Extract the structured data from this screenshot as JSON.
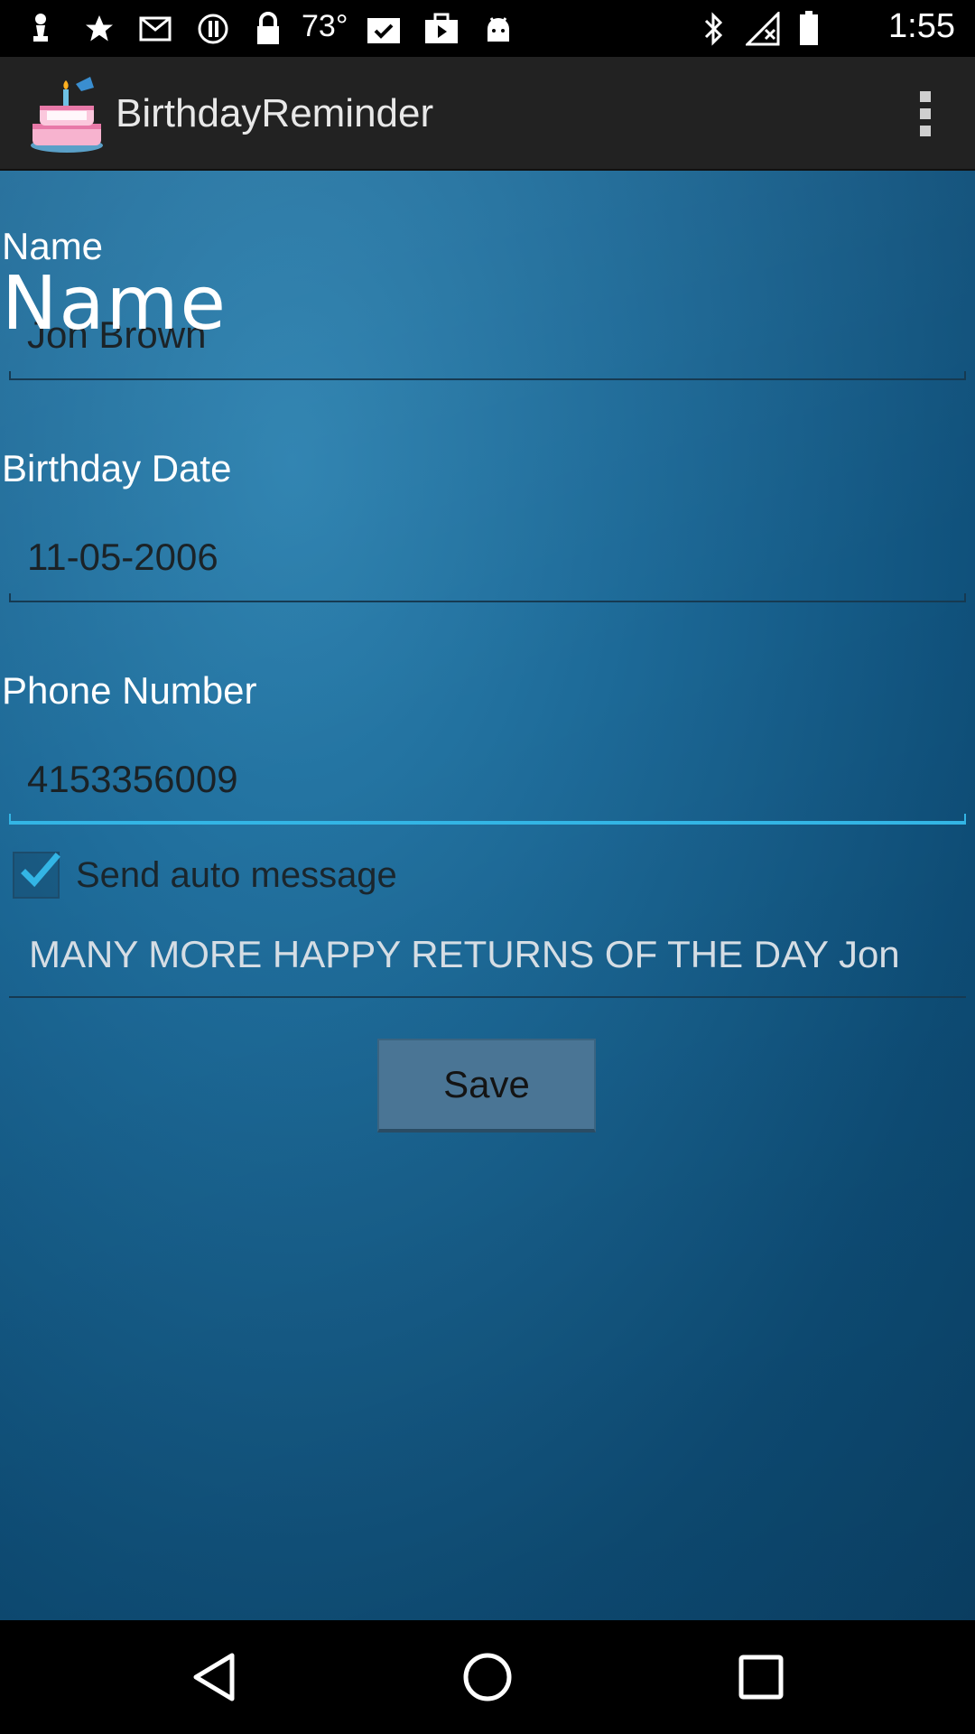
{
  "status_bar": {
    "temperature": "73°",
    "time": "1:55",
    "icons": [
      "chess-pawn-icon",
      "star-icon",
      "mail-icon",
      "info-circle-icon",
      "lock-icon",
      "temperature-text",
      "clipboard-check-icon",
      "briefcase-play-icon",
      "android-icon",
      "bluetooth-icon",
      "signal-off-icon",
      "battery-icon"
    ]
  },
  "action_bar": {
    "title": "BirthdayReminder",
    "icon": "birthday-cake-icon",
    "overflow": "overflow-menu-icon"
  },
  "form": {
    "name_label": "Name",
    "name_overlay": "Name",
    "name_value": "Jon Brown",
    "birthday_label": "Birthday Date",
    "birthday_value": "11-05-2006",
    "phone_label": "Phone Number",
    "phone_value": "4153356009",
    "auto_message_label": "Send auto message",
    "auto_message_checked": true,
    "message_value": "MANY MORE HAPPY RETURNS OF THE DAY Jon",
    "save_label": "Save"
  },
  "nav_bar": {
    "buttons": [
      "back-icon",
      "home-icon",
      "recents-icon"
    ]
  },
  "colors": {
    "accent": "#33b5e5",
    "background_top": "#2d82b0",
    "background_bottom": "#0b446b",
    "action_bar": "#222222",
    "button": "#4a7595"
  }
}
